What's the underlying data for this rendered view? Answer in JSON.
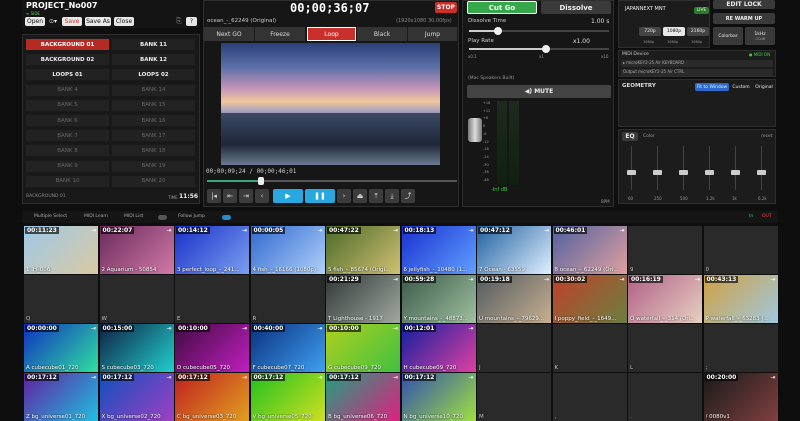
{
  "project": {
    "title": "PROJECT_No007",
    "sub": "≡ SIDE",
    "open": "Open",
    "save": "Save",
    "saveas": "Save As",
    "close": "Close",
    "help": "?"
  },
  "banks": {
    "left": [
      "BACKGROUND 01",
      "BACKGROUND 02",
      "LOOPS 01",
      "BANK 4",
      "BANK 5",
      "BANK 6",
      "BANK 7",
      "BANK 8",
      "BANK 9",
      "BANK 10"
    ],
    "right": [
      "BANK 11",
      "BANK 12",
      "LOOPS 02",
      "BANK 14",
      "BANK 15",
      "BANK 16",
      "BANK 17",
      "BANK 18",
      "BANK 19",
      "BANK 20"
    ],
    "footer": "BACKGROUND 01",
    "time_label": "TIME",
    "time": "11:56"
  },
  "preview": {
    "clip": "ocean_-_62249 (Original)",
    "timecode": "00;00;36;07",
    "res": "(1920x1080 30.00fps)",
    "stop": "STOP",
    "tabs": [
      "Next GO",
      "Freeze",
      "Loop",
      "Black",
      "Jump"
    ],
    "elapsed": "00;00;09;24 / 00;00;46;01",
    "transport": [
      "|◂",
      "⇤",
      "⇥",
      "‹",
      "▶",
      "❚❚",
      "›",
      "⏏",
      "⤒",
      "⤓",
      "⤴"
    ]
  },
  "mix": {
    "cut": "Cut Go",
    "dissolve": "Dissolve",
    "dtime_label": "Dissolve Time",
    "dtime": "1.00 s",
    "rate_label": "Play Rate",
    "rate": "x1.00",
    "rate_ticks": [
      "x0.1",
      "x1",
      "x10"
    ],
    "speakers": "(Mac Speakers Built)",
    "mute": "◀) MUTE",
    "db_ticks": [
      "+18",
      "+12",
      "+6",
      "0",
      "-6",
      "-12",
      "-18",
      "-24",
      "-30",
      "-36",
      "-48"
    ],
    "vol": "-Inf dB",
    "bpm": "BPM"
  },
  "right": {
    "device": "JAPANNEXT MNT",
    "live": "LIVE",
    "edit_lock": "EDIT LOCK",
    "warm": "RE WARM UP",
    "fps": [
      "720p",
      "1080p",
      "2160p"
    ],
    "fps_sub": [
      "1080p",
      "1080p",
      "1080p"
    ],
    "colorbar": "Colorbar",
    "khz": "1kHz",
    "khz_sub": "-20dB",
    "midi_label": "MIDI Device",
    "midi_badge": "● MIDI ON",
    "midi_in": "▸ microKEY2-25 Air KEYBOARD",
    "midi_out": "Output microKEY2-25 Air CTRL",
    "geometry": "GEOMETRY",
    "geo_opts": [
      "Fit to Window",
      "Custom",
      "Original"
    ],
    "eq": "EQ",
    "eq_color": "Color",
    "eq_reset": "reset",
    "eq_bands": [
      "60",
      "250",
      "500",
      "1.2k",
      "3k",
      "6.2k"
    ]
  },
  "grid_toolbar": {
    "multi": "Multiple Select",
    "learn": "MIDI Learn",
    "list": "MIDI List",
    "follow": "Follow Jump",
    "in": "In",
    "out": "OUT"
  },
  "clips": [
    {
      "t": "00:11:23",
      "n": "1 IH_006",
      "c": "#9ec9e8",
      "c2": "#d9c9a3"
    },
    {
      "t": "00:22:07",
      "n": "2 Aquarium - 50854",
      "c": "#6a2a5a",
      "c2": "#d07aa8"
    },
    {
      "t": "00:14:12",
      "n": "3 perfect_loop_-_241...",
      "c": "#1a2fc8",
      "c2": "#7aa0f0"
    },
    {
      "t": "00:00:05",
      "n": "4 fish_-_16166 (1080p)",
      "c": "#3068d0",
      "c2": "#b0d0f8"
    },
    {
      "t": "00:47:22",
      "n": "5 fish_-_85674 (Origi...",
      "c": "#4a6a2a",
      "c2": "#d0c070"
    },
    {
      "t": "00:18:13",
      "n": "6 jellyfish_-_10480 (1...",
      "c": "#1a30d0",
      "c2": "#60a0ff"
    },
    {
      "t": "00:47:12",
      "n": "7 Ocean - 63559",
      "c": "#2060a0",
      "c2": "#e0f0ff"
    },
    {
      "t": "00:46:01",
      "n": "8 ocean_-_62249 (Ori...",
      "c": "#5060a0",
      "c2": "#e0a0a0"
    },
    {
      "t": "",
      "n": "9",
      "c": "",
      "c2": ""
    },
    {
      "t": "",
      "n": "0",
      "c": "",
      "c2": ""
    },
    {
      "t": "",
      "n": "Q",
      "c": "",
      "c2": ""
    },
    {
      "t": "",
      "n": "W",
      "c": "",
      "c2": ""
    },
    {
      "t": "",
      "n": "E",
      "c": "",
      "c2": ""
    },
    {
      "t": "",
      "n": "R",
      "c": "",
      "c2": ""
    },
    {
      "t": "00:21:29",
      "n": "T Lighthouse - 1917",
      "c": "#303838",
      "c2": "#a0a8a0"
    },
    {
      "t": "00:59:28",
      "n": "Y mountains_-_48873...",
      "c": "#3a5a4a",
      "c2": "#a0c0a0"
    },
    {
      "t": "00:19:18",
      "n": "U mountains_-_79629...",
      "c": "#505a60",
      "c2": "#c8b090"
    },
    {
      "t": "00:30:02",
      "n": "I poppy_field_-_1649...",
      "c": "#c0402a",
      "c2": "#6a8040"
    },
    {
      "t": "00:16:19",
      "n": "O waterfall_-_314 (Ori...",
      "c": "#b06088",
      "c2": "#e8d0c0"
    },
    {
      "t": "00:43:13",
      "n": "P waterfall_-_63283 (...",
      "c": "#d0a040",
      "c2": "#a0c8e0"
    },
    {
      "t": "00:00:00",
      "n": "A cubecube01_720",
      "c": "#1030c0",
      "c2": "#30e0a0"
    },
    {
      "t": "00:15:00",
      "n": "S cubecube03_720",
      "c": "#102040",
      "c2": "#20d0d0"
    },
    {
      "t": "00:10:00",
      "n": "D cubecube05_720",
      "c": "#400a40",
      "c2": "#c020c0"
    },
    {
      "t": "00:40:00",
      "n": "F cubecube07_720",
      "c": "#0a3080",
      "c2": "#40a0f0"
    },
    {
      "t": "00:10:00",
      "n": "G cubecube09_720",
      "c": "#b0d020",
      "c2": "#40c040"
    },
    {
      "t": "00:12:01",
      "n": "H cubecube09_720",
      "c": "#1020a0",
      "c2": "#e040a0"
    },
    {
      "t": "",
      "n": "J",
      "c": "",
      "c2": ""
    },
    {
      "t": "",
      "n": "K",
      "c": "",
      "c2": ""
    },
    {
      "t": "",
      "n": "L",
      "c": "",
      "c2": ""
    },
    {
      "t": "",
      "n": ";",
      "c": "",
      "c2": ""
    },
    {
      "t": "00:17:12",
      "n": "Z bg_universe01_720",
      "c": "#6020a0",
      "c2": "#20c0e0"
    },
    {
      "t": "00:17:12",
      "n": "X bg_universe02_720",
      "c": "#1050c0",
      "c2": "#a040c0"
    },
    {
      "t": "00:17:12",
      "n": "C bg_universe03_720",
      "c": "#c02020",
      "c2": "#e0a020"
    },
    {
      "t": "00:17:12",
      "n": "V bg_universe05_720",
      "c": "#20c020",
      "c2": "#d0e020"
    },
    {
      "t": "00:17:12",
      "n": "B bg_universe06_720",
      "c": "#20a080",
      "c2": "#e02080"
    },
    {
      "t": "00:17:12",
      "n": "N bg_universe10_720",
      "c": "#3050b0",
      "c2": "#a0e040"
    },
    {
      "t": "",
      "n": "M",
      "c": "",
      "c2": ""
    },
    {
      "t": "",
      "n": ",",
      "c": "",
      "c2": ""
    },
    {
      "t": "",
      "n": ".",
      "c": "",
      "c2": ""
    },
    {
      "t": "00:20:00",
      "n": "/ 0080v1",
      "c": "#1a1a1a",
      "c2": "#804040"
    }
  ]
}
